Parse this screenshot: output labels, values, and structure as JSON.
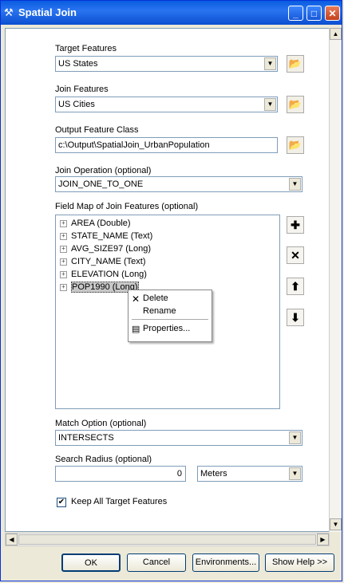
{
  "window": {
    "title": "Spatial Join"
  },
  "fields": {
    "target_label": "Target Features",
    "target_value": "US States",
    "join_label": "Join Features",
    "join_value": "US Cities",
    "output_label": "Output Feature Class",
    "output_value": "c:\\Output\\SpatialJoin_UrbanPopulation",
    "operation_label": "Join Operation (optional)",
    "operation_value": "JOIN_ONE_TO_ONE",
    "fieldmap_label": "Field Map of Join Features (optional)",
    "match_label": "Match Option (optional)",
    "match_value": "INTERSECTS",
    "radius_label": "Search Radius (optional)",
    "radius_value": "0",
    "radius_unit": "Meters",
    "keep_all_label": "Keep All Target Features",
    "keep_all_checked": true
  },
  "fieldmap": [
    "AREA (Double)",
    "STATE_NAME (Text)",
    "AVG_SIZE97 (Long)",
    "CITY_NAME (Text)",
    "ELEVATION (Long)",
    "POP1990 (Long)"
  ],
  "context_menu": {
    "delete": "Delete",
    "rename": "Rename",
    "properties": "Properties..."
  },
  "buttons": {
    "ok": "OK",
    "cancel": "Cancel",
    "environments": "Environments...",
    "show_help": "Show Help >>"
  },
  "icons": {
    "app": "hammer-icon",
    "folder": "open-folder-icon",
    "add": "plus-icon",
    "remove": "x-icon",
    "up": "arrow-up-icon",
    "down": "arrow-down-icon"
  }
}
